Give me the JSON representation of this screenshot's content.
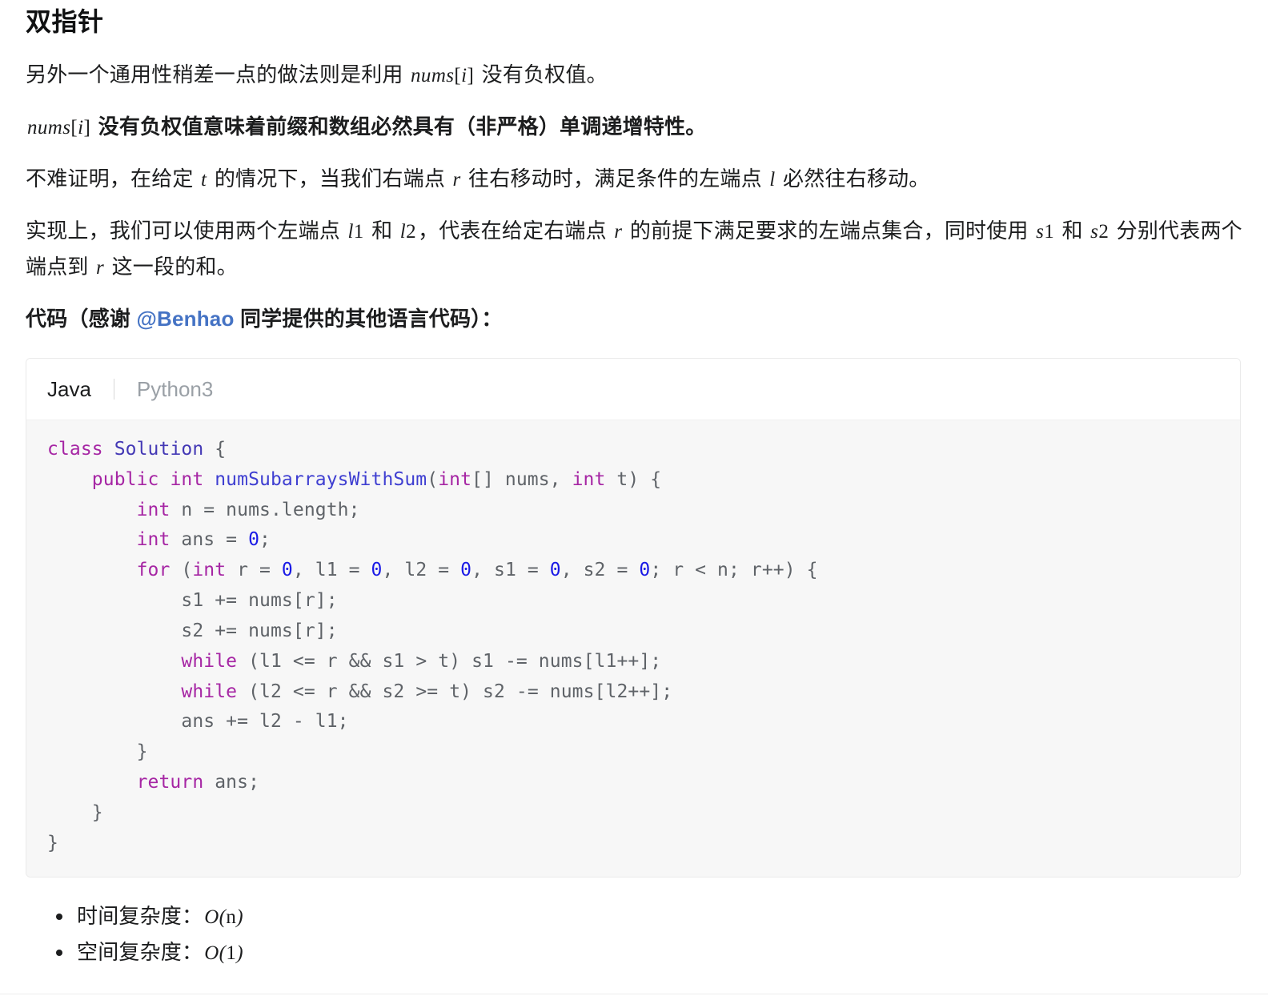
{
  "heading": "双指针",
  "paragraphs": [
    {
      "id": "p1",
      "bold": false,
      "parts": [
        {
          "type": "text",
          "value": "另外一个通用性稍差一点的做法则是利用 "
        },
        {
          "type": "math",
          "value": "nums[i]"
        },
        {
          "type": "text",
          "value": " 没有负权值。"
        }
      ]
    },
    {
      "id": "p2",
      "bold": true,
      "parts": [
        {
          "type": "math",
          "value": "nums[i]"
        },
        {
          "type": "text",
          "value": " 没有负权值意味着前缀和数组必然具有（非严格）单调递增特性。"
        }
      ]
    },
    {
      "id": "p3",
      "bold": false,
      "parts": [
        {
          "type": "text",
          "value": "不难证明，在给定 "
        },
        {
          "type": "math",
          "value": "t"
        },
        {
          "type": "text",
          "value": " 的情况下，当我们右端点 "
        },
        {
          "type": "math",
          "value": "r"
        },
        {
          "type": "text",
          "value": " 往右移动时，满足条件的左端点 "
        },
        {
          "type": "math",
          "value": "l"
        },
        {
          "type": "text",
          "value": " 必然往右移动。"
        }
      ]
    },
    {
      "id": "p4",
      "bold": false,
      "parts": [
        {
          "type": "text",
          "value": "实现上，我们可以使用两个左端点 "
        },
        {
          "type": "math",
          "value": "l1"
        },
        {
          "type": "text",
          "value": " 和 "
        },
        {
          "type": "math",
          "value": "l2"
        },
        {
          "type": "text",
          "value": "，代表在给定右端点 "
        },
        {
          "type": "math",
          "value": "r"
        },
        {
          "type": "text",
          "value": " 的前提下满足要求的左端点集合，同时使用 "
        },
        {
          "type": "math",
          "value": "s1"
        },
        {
          "type": "text",
          "value": " 和 "
        },
        {
          "type": "math",
          "value": "s2"
        },
        {
          "type": "text",
          "value": " 分别代表两个端点到 "
        },
        {
          "type": "math",
          "value": "r"
        },
        {
          "type": "text",
          "value": " 这一段的和。"
        }
      ]
    }
  ],
  "code_intro": {
    "prefix": "代码（感谢 ",
    "link": "@Benhao",
    "suffix": " 同学提供的其他语言代码）："
  },
  "code_card": {
    "tabs": [
      {
        "label": "Java",
        "active": true
      },
      {
        "label": "Python3",
        "active": false
      }
    ],
    "language": "Java",
    "code": "class Solution {\n    public int numSubarraysWithSum(int[] nums, int t) {\n        int n = nums.length;\n        int ans = 0;\n        for (int r = 0, l1 = 0, l2 = 0, s1 = 0, s2 = 0; r < n; r++) {\n            s1 += nums[r];\n            s2 += nums[r];\n            while (l1 <= r && s1 > t) s1 -= nums[l1++];\n            while (l2 <= r && s2 >= t) s2 -= nums[l2++];\n            ans += l2 - l1;\n        }\n        return ans;\n    }\n}"
  },
  "complexity": [
    {
      "label": "时间复杂度：",
      "value": "O(n)"
    },
    {
      "label": "空间复杂度：",
      "value": "O(1)"
    }
  ],
  "colors": {
    "link": "#4573c4",
    "keyword": "#a626a4",
    "type": "#4338b5",
    "function": "#3f3fd1",
    "number": "#1a1ae6",
    "code_bg": "#f7f7f7",
    "card_border": "#eaeaea",
    "text": "#1c1d1e"
  }
}
